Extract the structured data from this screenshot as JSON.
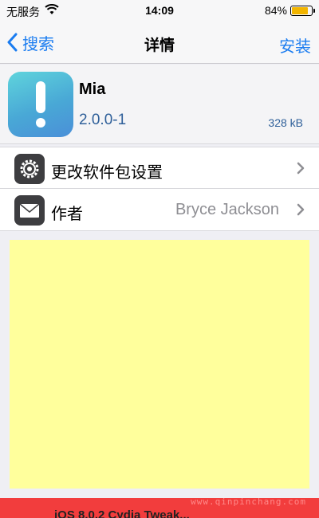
{
  "status_bar": {
    "carrier": "无服务",
    "time": "14:09",
    "battery_percent": "84%",
    "battery_level": 0.84
  },
  "nav": {
    "back_label": "搜索",
    "title": "详情",
    "action_label": "安装"
  },
  "app": {
    "name": "Mia",
    "version": "2.0.0-1",
    "size": "328 kB",
    "icon": "exclamation-app-icon"
  },
  "cells": [
    {
      "label": "更改软件包设置",
      "icon": "gear-icon",
      "value": ""
    },
    {
      "label": "作者",
      "icon": "mail-icon",
      "value": "Bryce Jackson"
    }
  ],
  "banner": {
    "text": "iOS 8.0.2 Cydia Tweak..."
  },
  "watermark": "www.qinpinchang.com",
  "colors": {
    "accent": "#1a7cf0",
    "ad_background": "#ffff9c",
    "banner": "#f23d3d"
  }
}
